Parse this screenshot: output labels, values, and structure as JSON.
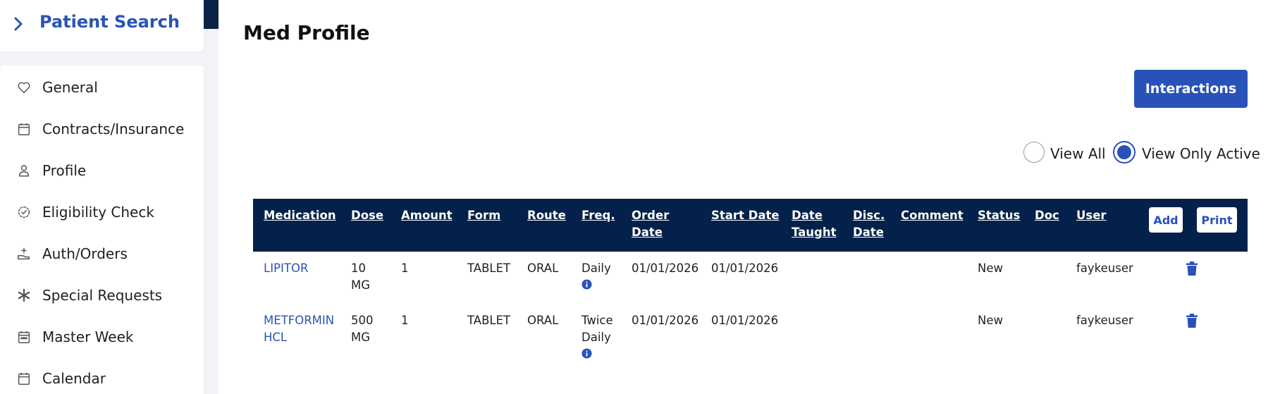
{
  "sidebar": {
    "search_title": "Patient Search",
    "items": [
      {
        "label": "General",
        "icon": "heart-icon"
      },
      {
        "label": "Contracts/Insurance",
        "icon": "calendar-icon"
      },
      {
        "label": "Profile",
        "icon": "person-icon"
      },
      {
        "label": "Eligibility Check",
        "icon": "badge-check-icon"
      },
      {
        "label": "Auth/Orders",
        "icon": "hand-plus-icon"
      },
      {
        "label": "Special Requests",
        "icon": "asterisk-icon"
      },
      {
        "label": "Master Week",
        "icon": "calendar-week-icon"
      },
      {
        "label": "Calendar",
        "icon": "calendar-icon"
      }
    ]
  },
  "main": {
    "title": "Med Profile",
    "interactions_button": "Interactions",
    "view_all_label": "View All",
    "view_active_label": "View Only Active",
    "selected_view": "View Only Active"
  },
  "table": {
    "headers": {
      "medication": "Medication",
      "dose": "Dose",
      "amount": "Amount",
      "form": "Form",
      "route": "Route",
      "freq": "Freq.",
      "order_date_1": "Order",
      "order_date_2": "Date",
      "start_date": "Start Date",
      "date_taught_1": "Date",
      "date_taught_2": "Taught",
      "disc_date_1": "Disc.",
      "disc_date_2": "Date",
      "comment": "Comment",
      "status": "Status",
      "doc": "Doc",
      "user": "User"
    },
    "add_button": "Add",
    "print_button": "Print",
    "rows": [
      {
        "medication_1": "LIPITOR",
        "medication_2": "",
        "dose_1": "10",
        "dose_2": "MG",
        "amount": "1",
        "form": "TABLET",
        "route": "ORAL",
        "freq_1": "Daily",
        "freq_2": "",
        "order_date": "01/01/2026",
        "start_date": "01/01/2026",
        "status": "New",
        "user": "faykeuser"
      },
      {
        "medication_1": "METFORMIN",
        "medication_2": "HCL",
        "dose_1": "500",
        "dose_2": "MG",
        "amount": "1",
        "form": "TABLET",
        "route": "ORAL",
        "freq_1": "Twice",
        "freq_2": "Daily",
        "order_date": "01/01/2026",
        "start_date": "01/01/2026",
        "status": "New",
        "user": "faykeuser"
      }
    ]
  },
  "colors": {
    "accent": "#2952b8",
    "header_bg": "#03214a",
    "sidebar_bg": "#f2f3f6"
  }
}
